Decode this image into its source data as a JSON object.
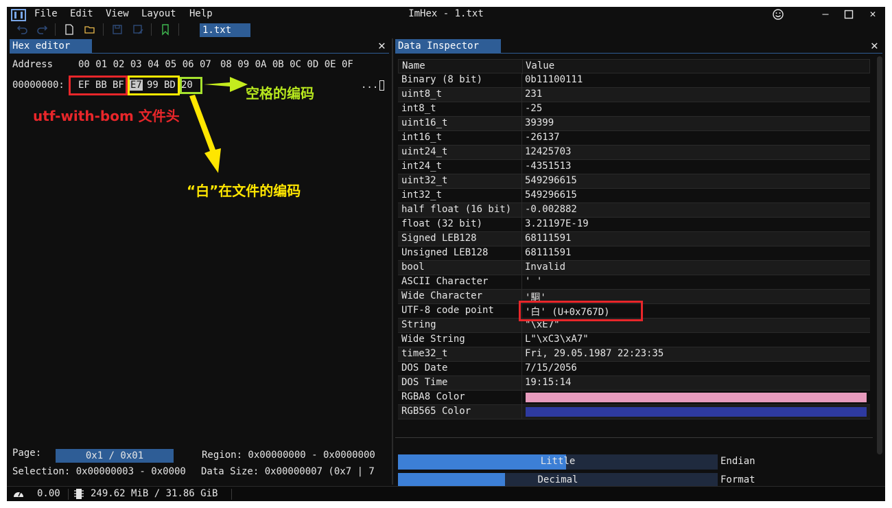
{
  "app": {
    "title": "ImHex - 1.txt",
    "menu": [
      "File",
      "Edit",
      "View",
      "Layout",
      "Help"
    ],
    "open_file_tab": "1.txt"
  },
  "hex_editor": {
    "tab_label": "Hex editor",
    "address_label": "Address",
    "column_header_1": "00 01 02 03 04 05 06 07",
    "column_header_2": "08 09 0A 0B 0C 0D 0E 0F",
    "row_address": "00000000:",
    "bytes": [
      "EF",
      "BB",
      "BF",
      "E7",
      "99",
      "BD",
      "20"
    ],
    "ascii_preview": "...",
    "page_label": "Page:",
    "page_value": "0x1 / 0x01",
    "region_text": "Region: 0x00000000 - 0x0000000",
    "selection_text": "Selection: 0x00000003 - 0x0000",
    "data_size_text": "Data Size: 0x00000007 (0x7 | 7"
  },
  "annotations": {
    "bom_label": "utf-with-bom 文件头",
    "space_label": "空格的编码",
    "bai_label": "“白”在文件的编码"
  },
  "data_inspector": {
    "tab_label": "Data Inspector",
    "col_name": "Name",
    "col_value": "Value",
    "rows": [
      {
        "name": "Binary (8 bit)",
        "value": "0b11100111"
      },
      {
        "name": "uint8_t",
        "value": "231"
      },
      {
        "name": "int8_t",
        "value": "-25"
      },
      {
        "name": "uint16_t",
        "value": "39399"
      },
      {
        "name": "int16_t",
        "value": "-26137"
      },
      {
        "name": "uint24_t",
        "value": "12425703"
      },
      {
        "name": "int24_t",
        "value": "-4351513"
      },
      {
        "name": "uint32_t",
        "value": "549296615"
      },
      {
        "name": "int32_t",
        "value": "549296615"
      },
      {
        "name": "half float (16 bit)",
        "value": "-0.002882"
      },
      {
        "name": "float (32 bit)",
        "value": "3.21197E-19"
      },
      {
        "name": "Signed LEB128",
        "value": "68111591"
      },
      {
        "name": "Unsigned LEB128",
        "value": "68111591"
      },
      {
        "name": "bool",
        "value": "Invalid"
      },
      {
        "name": "ASCII Character",
        "value": "' '"
      },
      {
        "name": "Wide Character",
        "value": "'駧'"
      },
      {
        "name": "UTF-8 code point",
        "value": "'白' (U+0x767D)"
      },
      {
        "name": "String",
        "value": "\"\\xE7\""
      },
      {
        "name": "Wide String",
        "value": "L\"\\xC3\\xA7\""
      },
      {
        "name": "time32_t",
        "value": "Fri, 29.05.1987 22:23:35"
      },
      {
        "name": "DOS Date",
        "value": "7/15/2056"
      },
      {
        "name": "DOS Time",
        "value": "19:15:14"
      },
      {
        "name": "RGBA8 Color",
        "value": ""
      },
      {
        "name": "RGB565 Color",
        "value": ""
      }
    ],
    "rgba8_color": "#e79bbd",
    "rgb565_color": "#2e3aa0",
    "endian_value": "Little",
    "endian_label": "Endian",
    "format_value": "Decimal",
    "format_label": "Format"
  },
  "status_bar": {
    "fps": "0.00",
    "memory": "249.62 MiB / 31.86 GiB"
  },
  "colors": {
    "accent": "#2e5d96",
    "red_box": "#e8262a",
    "yellow_box": "#ffea00",
    "green_box": "#a6e22e",
    "annotation_red": "#e8262a",
    "annotation_yellow": "#ffe600",
    "annotation_green": "#b6e61e"
  }
}
